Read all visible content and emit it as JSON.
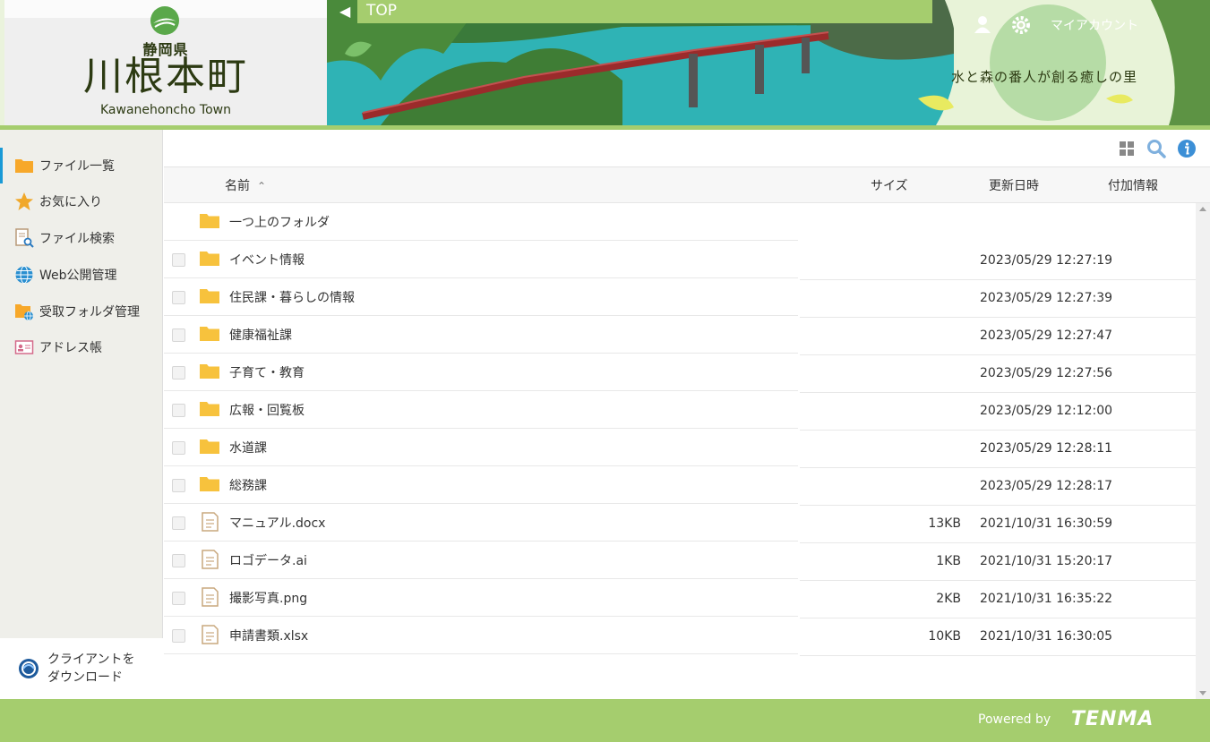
{
  "header": {
    "pref_name": "静岡県",
    "town_name": "川根本町",
    "town_name_en": "Kawanehoncho Town",
    "breadcrumb": "TOP",
    "my_account": "マイアカウント",
    "tagline": "水と森の番人が創る癒しの里"
  },
  "sidebar": {
    "items": [
      {
        "label": "ファイル一覧",
        "icon": "folder-icon",
        "active": true
      },
      {
        "label": "お気に入り",
        "icon": "star-icon",
        "active": false
      },
      {
        "label": "ファイル検索",
        "icon": "file-search-icon",
        "active": false
      },
      {
        "label": "Web公開管理",
        "icon": "globe-icon",
        "active": false
      },
      {
        "label": "受取フォルダ管理",
        "icon": "folder-globe-icon",
        "active": false
      },
      {
        "label": "アドレス帳",
        "icon": "address-card-icon",
        "active": false
      }
    ],
    "client_download": {
      "line1": "クライアントを",
      "line2": "ダウンロード"
    }
  },
  "toolbar": {
    "buttons": [
      "grid-view-icon",
      "search-icon",
      "info-icon"
    ]
  },
  "table": {
    "columns": {
      "name": "名前",
      "size": "サイズ",
      "updated": "更新日時",
      "extra": "付加情報"
    },
    "parent_folder": "一つ上のフォルダ",
    "rows": [
      {
        "type": "folder",
        "name": "イベント情報",
        "size": "",
        "date": "2023/05/29 12:27:19"
      },
      {
        "type": "folder",
        "name": "住民課・暮らしの情報",
        "size": "",
        "date": "2023/05/29 12:27:39"
      },
      {
        "type": "folder",
        "name": "健康福祉課",
        "size": "",
        "date": "2023/05/29 12:27:47"
      },
      {
        "type": "folder",
        "name": "子育て・教育",
        "size": "",
        "date": "2023/05/29 12:27:56"
      },
      {
        "type": "folder",
        "name": "広報・回覧板",
        "size": "",
        "date": "2023/05/29 12:12:00"
      },
      {
        "type": "folder",
        "name": "水道課",
        "size": "",
        "date": "2023/05/29 12:28:11"
      },
      {
        "type": "folder",
        "name": "総務課",
        "size": "",
        "date": "2023/05/29 12:28:17"
      },
      {
        "type": "file",
        "name": "マニュアル.docx",
        "size": "13KB",
        "date": "2021/10/31 16:30:59"
      },
      {
        "type": "file",
        "name": "ロゴデータ.ai",
        "size": "1KB",
        "date": "2021/10/31 15:20:17"
      },
      {
        "type": "file",
        "name": "撮影写真.png",
        "size": "2KB",
        "date": "2021/10/31 16:35:22"
      },
      {
        "type": "file",
        "name": "申請書類.xlsx",
        "size": "10KB",
        "date": "2021/10/31 16:30:05"
      }
    ]
  },
  "footer": {
    "powered_by": "Powered by",
    "brand": "TENMA"
  },
  "colors": {
    "accent_green": "#a5cd6e",
    "folder_yellow": "#f7c23d",
    "active_blue": "#1a9ad6"
  }
}
